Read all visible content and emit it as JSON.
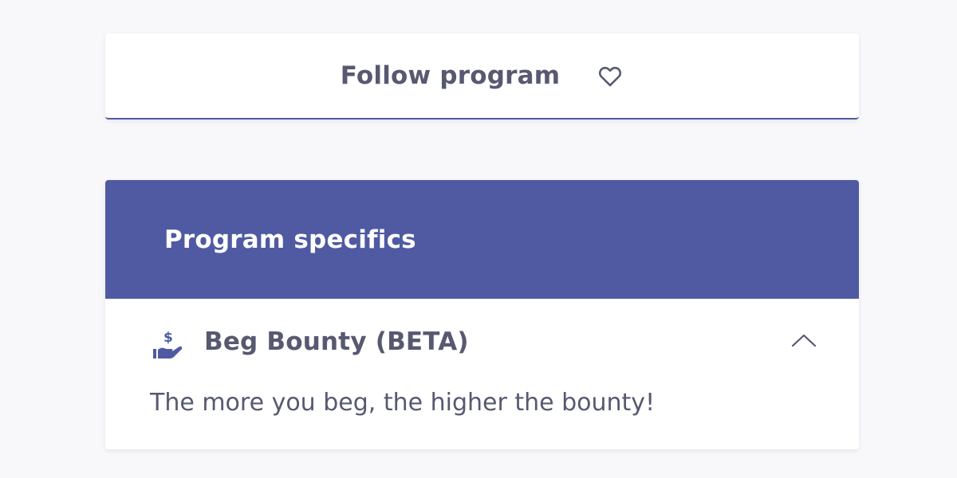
{
  "follow": {
    "label": "Follow program",
    "icon": "heart-outline-icon"
  },
  "specifics": {
    "title": "Program specifics",
    "header_color": "#4f5aa2",
    "item": {
      "icon": "hand-dollar-icon",
      "title": "Beg Bounty (BETA)",
      "expanded": true,
      "toggle_icon": "chevron-up-icon",
      "description": "The more you beg, the higher the bounty!"
    }
  }
}
